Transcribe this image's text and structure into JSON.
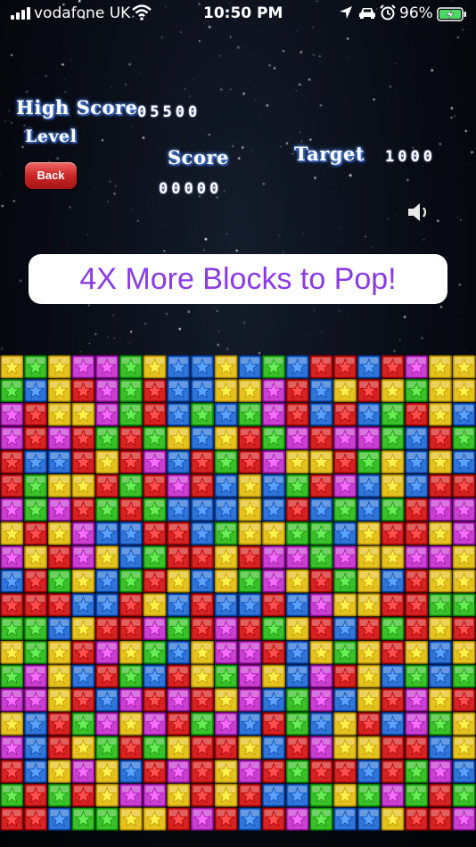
{
  "status_bar": {
    "carrier": "vodafone UK",
    "time": "10:50 PM",
    "battery_percent": "96%",
    "icons": [
      "signal-icon",
      "wifi-icon",
      "location-icon",
      "car-icon",
      "alarm-icon",
      "battery-charging-icon"
    ]
  },
  "game": {
    "high_score_label": "High Score",
    "high_score_value": "05500",
    "level_label": "Level",
    "score_label": "Score",
    "score_value": "00000",
    "target_label": "Target",
    "target_value": "1000",
    "back_label": "Back",
    "sound_icon": "speaker-icon"
  },
  "promo": {
    "text": "4X More Blocks to Pop!"
  },
  "board": {
    "cols": 20,
    "rows": 20,
    "colors": {
      "Y": "#e6c21f",
      "G": "#3bbf2a",
      "M": "#c93fd0",
      "B": "#2f74d6",
      "R": "#d52222"
    },
    "grid": [
      "YGYMMGYBBYBGBRRBRMYY",
      "GBYRMGRBBYYMRBYRYGYY",
      "MRYYMGRBGBGMRBRBGRYB",
      "MRMRGRGYBYRGMRMMGBRG",
      "RBBRYRMBRGRMYYRGYBYB",
      "RGYYRGRMRBYBGRMBYBRR",
      "MGMRGRGBBBYBRBGBGRMM",
      "YRYMBBRRBGYYGGBYRRYM",
      "MYRMYBGRRYRMMGMYYMMY",
      "BRGYBGRYBYGMYRGYBRYY",
      "RRRBBRYBRBBRBMYYRRGG",
      "GGBYRRMGRMRGYRBRGRYR",
      "YGYRMYGBYMMRBYGYRYBY",
      "GMYBRGBRYGMYBMRYBGBG",
      "MMYRBMRMRYMBGMBYRMYR",
      "YBRGMYMRGMBRGBYRBMGY",
      "MBRYGRGYRRYBRMYYRRBY",
      "RBYMYBRMRYMRGRRBRGMB",
      "GRGRYMMYRYRBBGYGMGRG",
      "RRBGGYYRMRBRMGBBYRRM"
    ]
  }
}
